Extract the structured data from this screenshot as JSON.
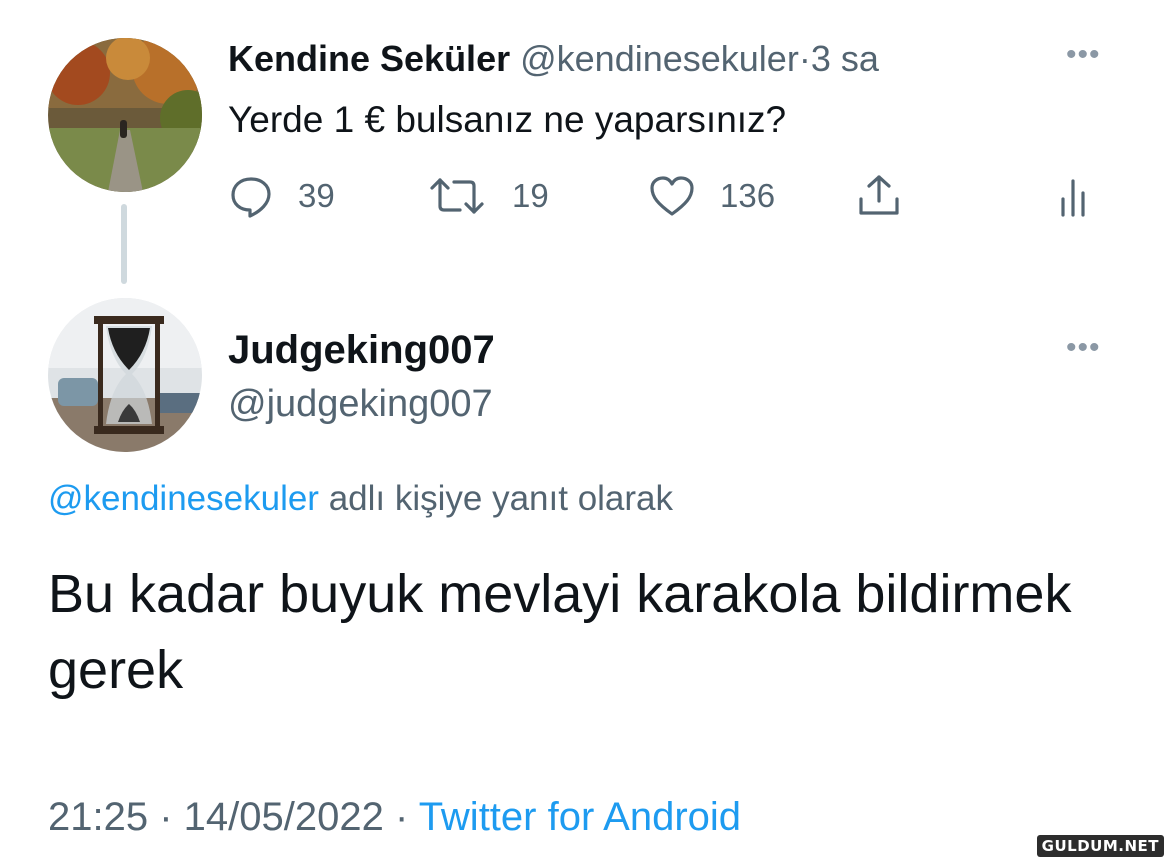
{
  "tweet": {
    "author": {
      "name": "Kendine Seküler",
      "handle": "@kendinesekuler"
    },
    "separator": "·",
    "time": "3 sa",
    "more_label": "•••",
    "text": "Yerde 1 € bulsanız ne yaparsınız?",
    "actions": {
      "replies": "39",
      "retweets": "19",
      "likes": "136"
    }
  },
  "reply": {
    "author": {
      "name": "Judgeking007",
      "handle": "@judgeking007"
    },
    "more_label": "•••",
    "replying_to": {
      "mention": "@kendinesekuler",
      "suffix": " adlı kişiye yanıt olarak"
    },
    "text": "Bu kadar buyuk mevlayi karakola bildirmek gerek",
    "meta": {
      "time": "21:25",
      "separator": " · ",
      "date": "14/05/2022",
      "source": "Twitter for Android"
    }
  },
  "watermark": "GULDUM.NET",
  "colors": {
    "text": "#0f1419",
    "secondary": "#536471",
    "accent": "#1d9bf0",
    "thread_line": "#cfd9de"
  },
  "icons": [
    "reply-icon",
    "retweet-icon",
    "like-icon",
    "share-icon",
    "analytics-icon",
    "more-icon"
  ]
}
